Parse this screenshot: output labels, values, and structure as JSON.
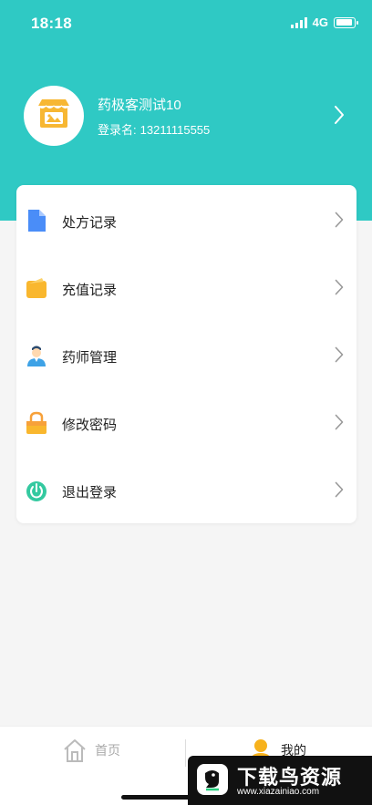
{
  "status_bar": {
    "time": "18:18",
    "network": "4G",
    "battery_level": 0.9
  },
  "profile": {
    "name": "药极客测试10",
    "login_label": "登录名:",
    "login_value": "13211115555",
    "avatar_icon": "shop-icon",
    "chevron_icon": "chevron-right-icon"
  },
  "menu": {
    "items": [
      {
        "label": "处方记录",
        "icon": "document-icon"
      },
      {
        "label": "充值记录",
        "icon": "wallet-icon"
      },
      {
        "label": "药师管理",
        "icon": "pharmacist-icon"
      },
      {
        "label": "修改密码",
        "icon": "lock-icon"
      },
      {
        "label": "退出登录",
        "icon": "power-icon"
      }
    ]
  },
  "tab_bar": {
    "tabs": [
      {
        "label": "首页",
        "icon": "home-icon",
        "active": false
      },
      {
        "label": "我的",
        "icon": "person-icon",
        "active": true
      }
    ]
  },
  "watermark": {
    "title": "下载鸟资源",
    "url": "www.xiazainiao.com"
  },
  "colors": {
    "primary": "#2fc9c4",
    "background": "#f5f5f5",
    "card": "#ffffff"
  }
}
